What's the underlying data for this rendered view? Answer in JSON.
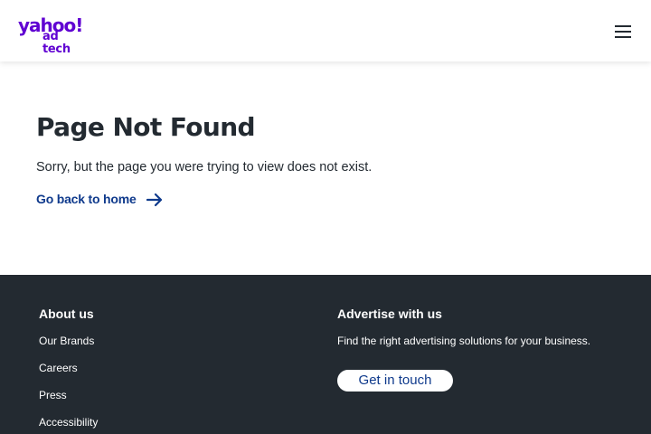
{
  "header": {
    "logo_main": "yahoo!",
    "logo_sub": "ad tech",
    "menu_icon": "hamburger-menu-icon"
  },
  "main": {
    "title": "Page Not Found",
    "description": "Sorry, but the page you were trying to view does not exist.",
    "home_link_label": "Go back to home",
    "home_link_icon": "arrow-right-icon"
  },
  "footer": {
    "about": {
      "title": "About us",
      "links": [
        "Our Brands",
        "Careers",
        "Press",
        "Accessibility"
      ]
    },
    "advertise": {
      "title": "Advertise with us",
      "text": "Find the right advertising solutions for your business.",
      "button_label": "Get in touch"
    }
  },
  "colors": {
    "brand_purple": "#6001d2",
    "link_blue": "#0f3a8c",
    "text_dark": "#232a31",
    "footer_bg": "#232a31",
    "background": "#ffffff"
  }
}
